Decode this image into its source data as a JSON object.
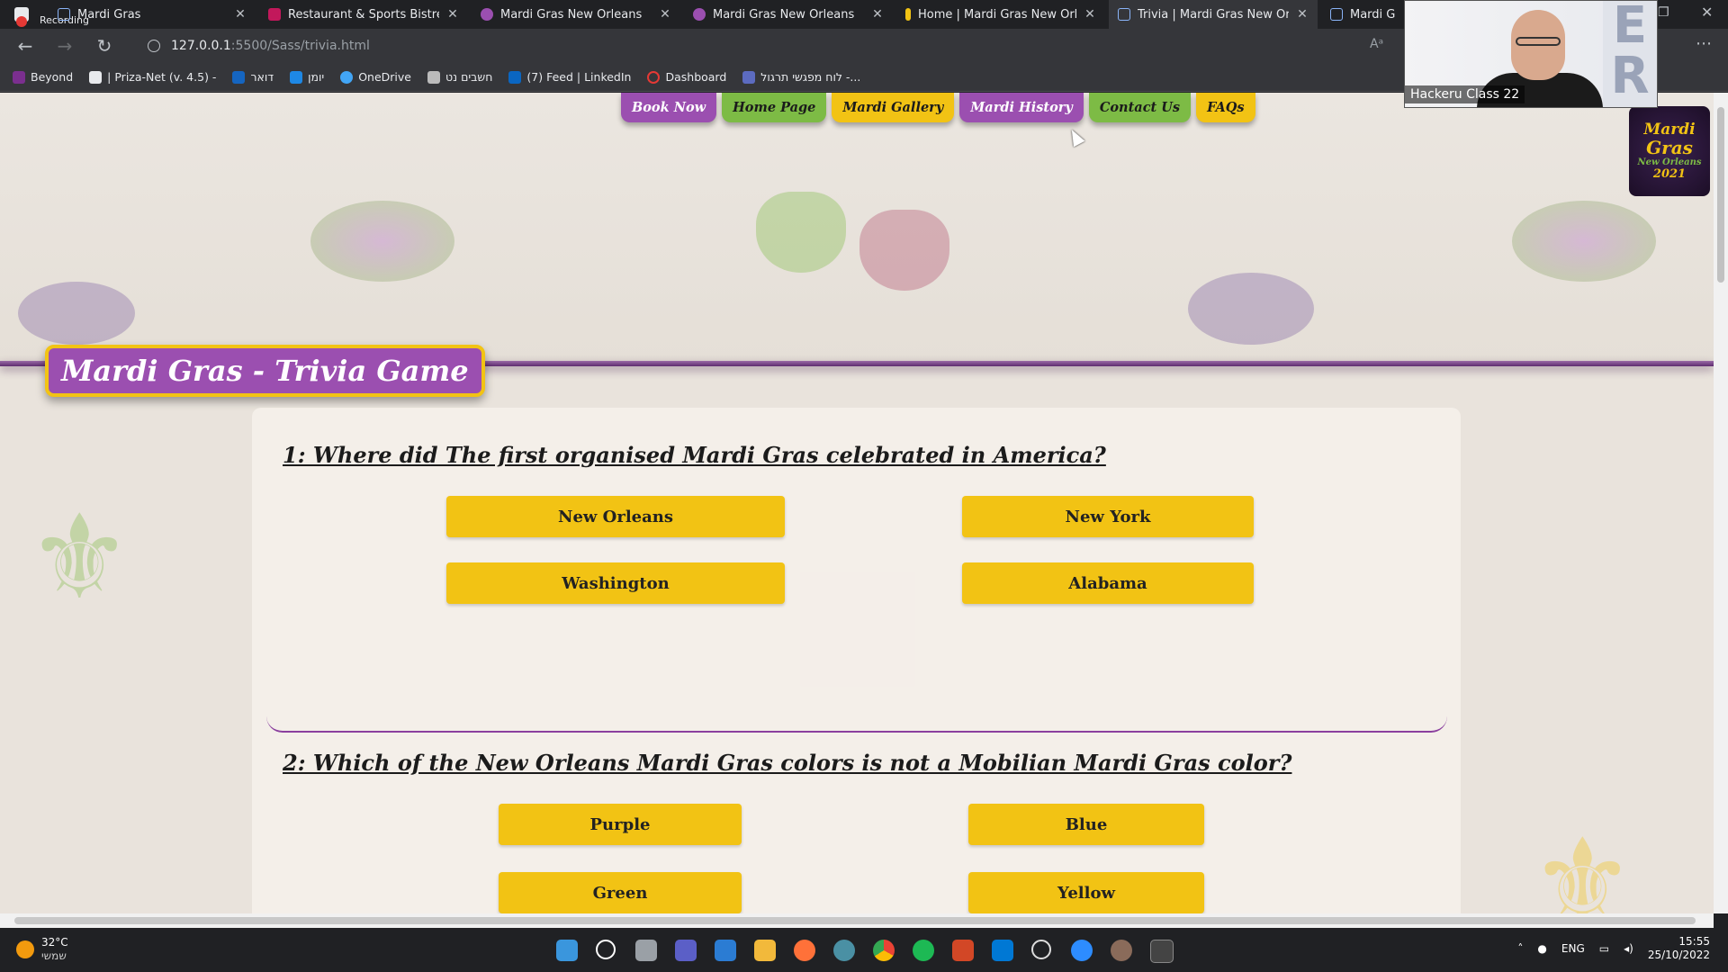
{
  "browser": {
    "recording_label": "Recording",
    "tabs": [
      {
        "title": "Mardi Gras",
        "color": "#8ab4f8"
      },
      {
        "title": "Restaurant & Sports Bistreaux | \\",
        "color": "#c2185b"
      },
      {
        "title": "Mardi Gras New Orleans",
        "color": "#9b4fb0"
      },
      {
        "title": "Mardi Gras New Orleans",
        "color": "#9b4fb0"
      },
      {
        "title": "Home | Mardi Gras New Orleans",
        "color": "#f2c314"
      },
      {
        "title": "Trivia | Mardi Gras New Orleans",
        "color": "#8ab4f8"
      },
      {
        "title": "Mardi Gra",
        "color": "#8ab4f8"
      }
    ],
    "url_host": "127.0.0.1",
    "url_path": ":5500/Sass/trivia.html",
    "bookmarks": [
      {
        "label": "Beyond",
        "color": "#7b2f8f"
      },
      {
        "label": "| Priza-Net (v. 4.5) -",
        "color": "#e8eaed"
      },
      {
        "label": "דואר",
        "color": "#1565c0"
      },
      {
        "label": "יומן",
        "color": "#1e88e5"
      },
      {
        "label": "OneDrive",
        "color": "#42a5f5"
      },
      {
        "label": "חשבים נט",
        "color": "#bbbbbb"
      },
      {
        "label": "(7) Feed | LinkedIn",
        "color": "#0a66c2"
      },
      {
        "label": "Dashboard",
        "color": "#e53935"
      },
      {
        "label": "לוח מפגשי תרגול -...",
        "color": "#5c6bc0"
      }
    ]
  },
  "nav": {
    "items": [
      "Book Now",
      "Home Page",
      "Mardi Gallery",
      "Mardi History",
      "Contact Us",
      "FAQs"
    ],
    "colors": [
      "#9b4fb0",
      "#7dbb45",
      "#f2c314",
      "#9b4fb0",
      "#7dbb45",
      "#f2c314"
    ]
  },
  "logo": {
    "line1": "Mardi",
    "line2": "Gras",
    "line3": "New Orleans",
    "line4": "2021"
  },
  "page": {
    "title": "Mardi Gras - Trivia Game"
  },
  "questions": [
    {
      "text": "1: Where did The first organised Mardi Gras celebrated in America?",
      "answers": [
        "New Orleans",
        "New York",
        "Washington",
        "Alabama"
      ]
    },
    {
      "text": "2: Which of the New Orleans Mardi Gras colors is not a Mobilian Mardi Gras color?",
      "answers": [
        "Purple",
        "Blue",
        "Green",
        "Yellow"
      ]
    }
  ],
  "webcam": {
    "label": "Hackeru Class 22"
  },
  "taskbar": {
    "temperature": "32°C",
    "weather_desc": "שמשי",
    "language": "ENG",
    "time": "15:55",
    "date": "25/10/2022"
  }
}
